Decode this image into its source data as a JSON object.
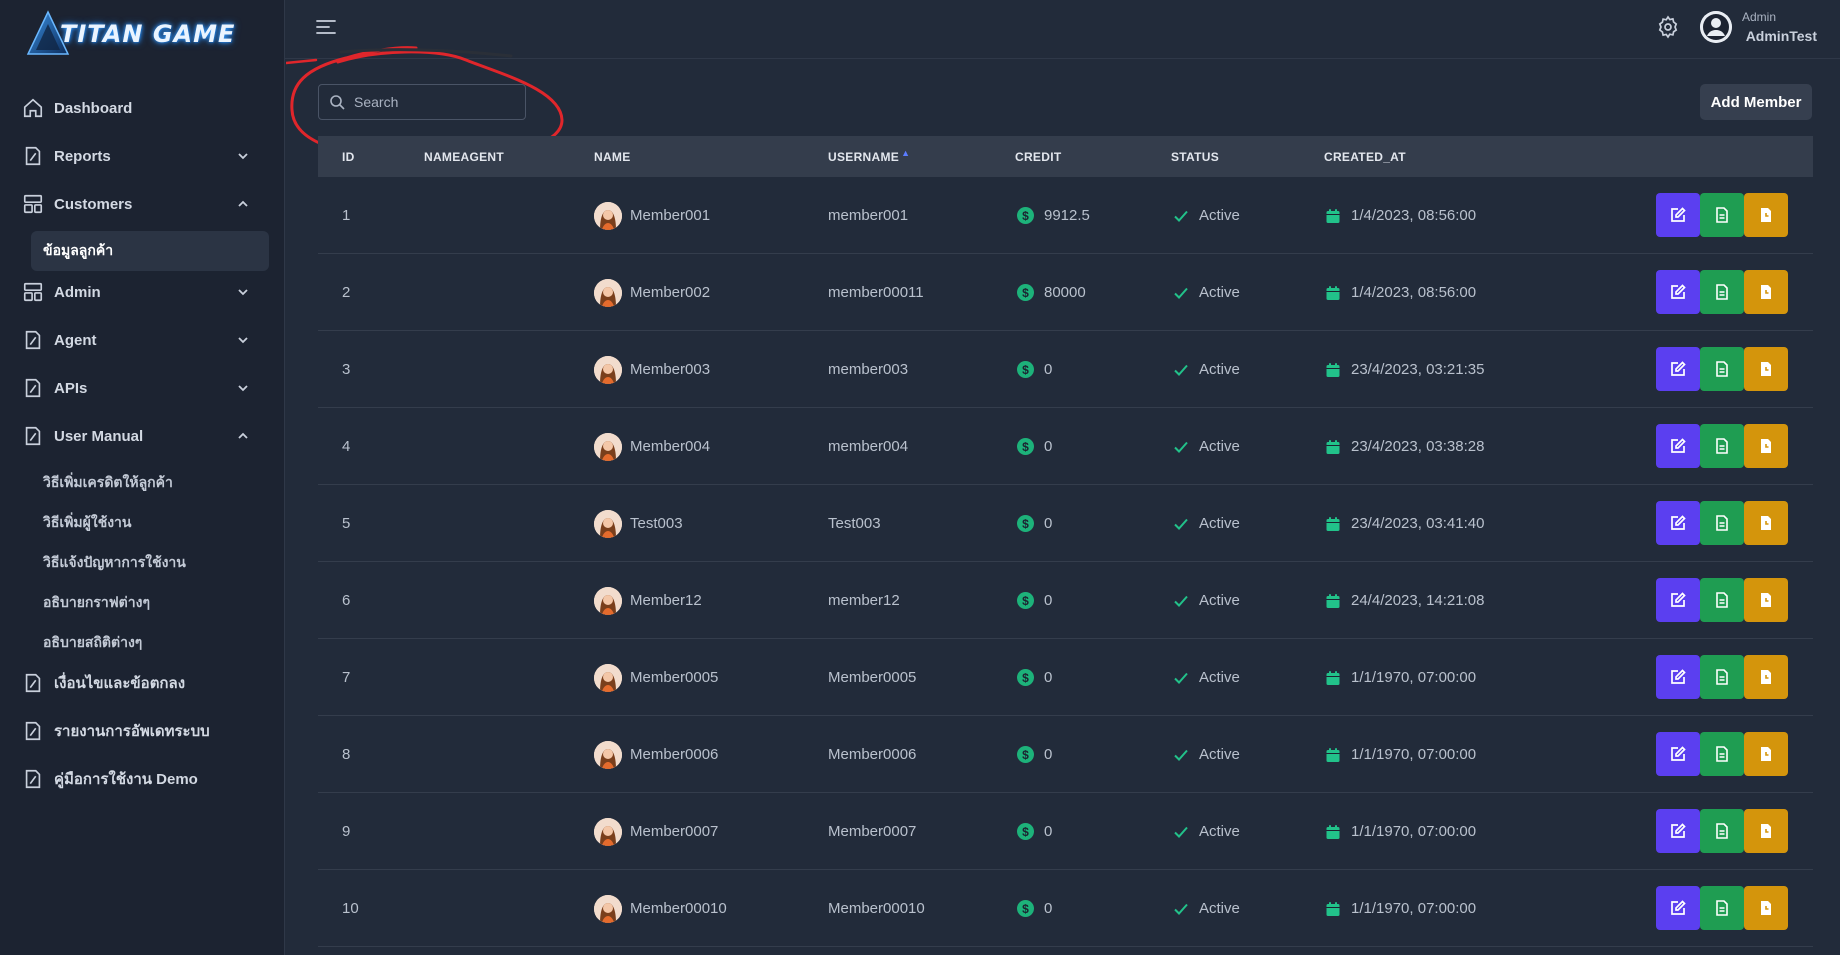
{
  "app": {
    "logo_text": "TITAN GAME"
  },
  "sidebar": {
    "items": [
      {
        "label": "Dashboard",
        "icon": "home-icon"
      },
      {
        "label": "Reports",
        "icon": "reports-icon"
      },
      {
        "label": "Customers",
        "icon": "customers-icon"
      },
      {
        "label": "Admin",
        "icon": "admin-icon"
      },
      {
        "label": "Agent",
        "icon": "agent-icon"
      },
      {
        "label": "APIs",
        "icon": "apis-icon"
      },
      {
        "label": "User Manual",
        "icon": "manual-icon"
      },
      {
        "label": "เงื่อนไขและข้อตกลง",
        "icon": "terms-icon"
      },
      {
        "label": "รายงานการอัพเดทระบบ",
        "icon": "update-report-icon"
      },
      {
        "label": "คู่มือการใช้งาน Demo",
        "icon": "demo-manual-icon"
      }
    ],
    "customers_sub": "ข้อมูลลูกค้า",
    "manual_sub": [
      "วิธีเพิ่มเครดิตให้ลูกค้า",
      "วิธีเพิ่มผู้ใช้งาน",
      "วิธีแจ้งปัญหาการใช้งาน",
      "อธิบายกราฟต่างๆ",
      "อธิบายสถิติต่างๆ"
    ]
  },
  "header": {
    "user_role": "Admin",
    "user_name": "AdminTest"
  },
  "search": {
    "placeholder": "Search",
    "value": ""
  },
  "toolbar": {
    "add_label": "Add Member"
  },
  "table": {
    "columns": [
      "ID",
      "NAMEAGENT",
      "NAME",
      "USERNAME",
      "CREDIT",
      "STATUS",
      "CREATED_AT"
    ],
    "rows": [
      {
        "id": "1",
        "name": "Member001",
        "username": "member001",
        "credit": "9912.5",
        "status": "Active",
        "created": "1/4/2023, 08:56:00"
      },
      {
        "id": "2",
        "name": "Member002",
        "username": "member00011",
        "credit": "80000",
        "status": "Active",
        "created": "1/4/2023, 08:56:00"
      },
      {
        "id": "3",
        "name": "Member003",
        "username": "member003",
        "credit": "0",
        "status": "Active",
        "created": "23/4/2023, 03:21:35"
      },
      {
        "id": "4",
        "name": "Member004",
        "username": "member004",
        "credit": "0",
        "status": "Active",
        "created": "23/4/2023, 03:38:28"
      },
      {
        "id": "5",
        "name": "Test003",
        "username": "Test003",
        "credit": "0",
        "status": "Active",
        "created": "23/4/2023, 03:41:40"
      },
      {
        "id": "6",
        "name": "Member12",
        "username": "member12",
        "credit": "0",
        "status": "Active",
        "created": "24/4/2023, 14:21:08"
      },
      {
        "id": "7",
        "name": "Member0005",
        "username": "Member0005",
        "credit": "0",
        "status": "Active",
        "created": "1/1/1970, 07:00:00"
      },
      {
        "id": "8",
        "name": "Member0006",
        "username": "Member0006",
        "credit": "0",
        "status": "Active",
        "created": "1/1/1970, 07:00:00"
      },
      {
        "id": "9",
        "name": "Member0007",
        "username": "Member0007",
        "credit": "0",
        "status": "Active",
        "created": "1/1/1970, 07:00:00"
      },
      {
        "id": "10",
        "name": "Member00010",
        "username": "Member00010",
        "credit": "0",
        "status": "Active",
        "created": "1/1/1970, 07:00:00"
      }
    ]
  },
  "colors": {
    "edit": "#5b3ff0",
    "doc": "#1f9d52",
    "file": "#d4950c",
    "active": "#22c28a",
    "annotation": "#e0262b"
  }
}
